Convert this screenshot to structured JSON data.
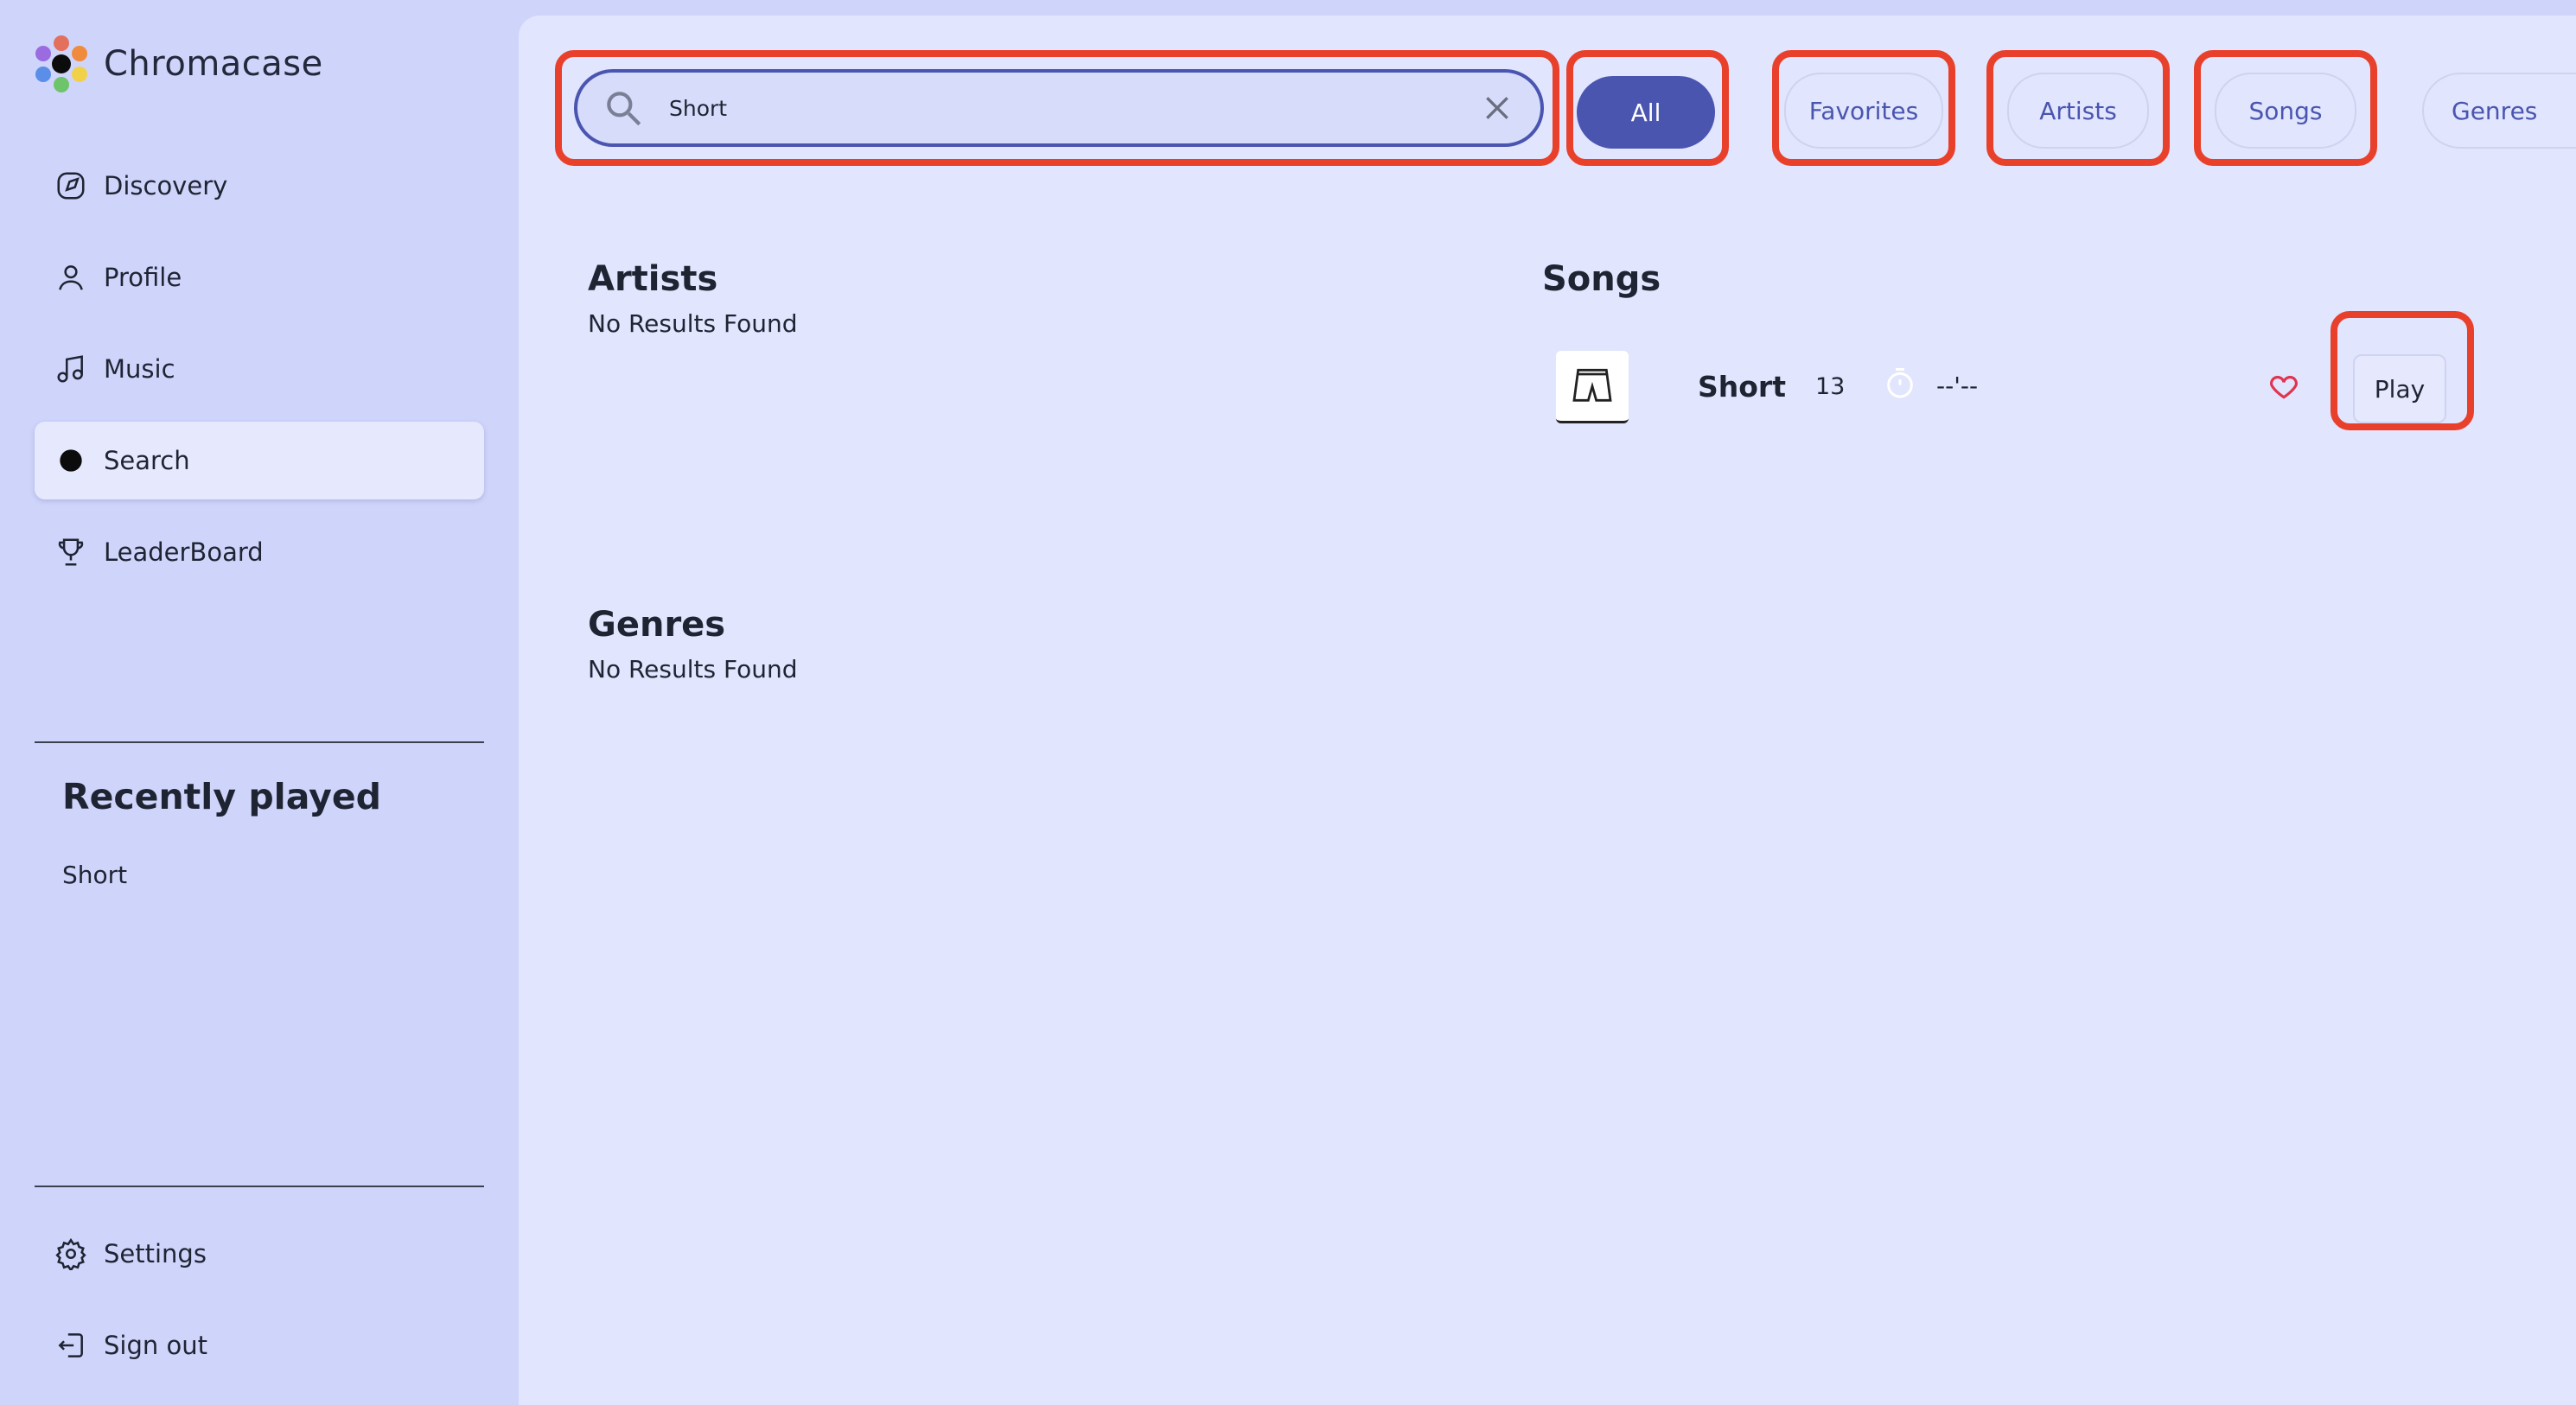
{
  "app": {
    "name": "Chromacase"
  },
  "sidebar": {
    "items": [
      {
        "label": "Discovery",
        "icon": "discovery-icon"
      },
      {
        "label": "Profile",
        "icon": "profile-icon"
      },
      {
        "label": "Music",
        "icon": "music-icon"
      },
      {
        "label": "Search",
        "icon": "search-dot-icon",
        "active": true
      },
      {
        "label": "LeaderBoard",
        "icon": "trophy-icon"
      }
    ],
    "recent_title": "Recently played",
    "recent_items": [
      "Short"
    ],
    "bottom_items": [
      {
        "label": "Settings",
        "icon": "gear-icon"
      },
      {
        "label": "Sign out",
        "icon": "sign-out-icon"
      }
    ]
  },
  "search": {
    "value": "Short"
  },
  "filters": [
    {
      "label": "All",
      "active": true
    },
    {
      "label": "Favorites"
    },
    {
      "label": "Artists"
    },
    {
      "label": "Songs"
    },
    {
      "label": "Genres"
    }
  ],
  "results": {
    "artists": {
      "title": "Artists",
      "empty_text": "No Results Found"
    },
    "songs": {
      "title": "Songs",
      "items": [
        {
          "name": "Short",
          "count": "13",
          "duration": "--'--",
          "action": "Play"
        }
      ]
    },
    "genres": {
      "title": "Genres",
      "empty_text": "No Results Found"
    }
  },
  "colors": {
    "accent": "#4a55b0",
    "highlight": "#e8402b",
    "sidebar_bg": "#cfd4fb",
    "main_bg": "#e1e5fd",
    "heart": "#e0344f"
  }
}
